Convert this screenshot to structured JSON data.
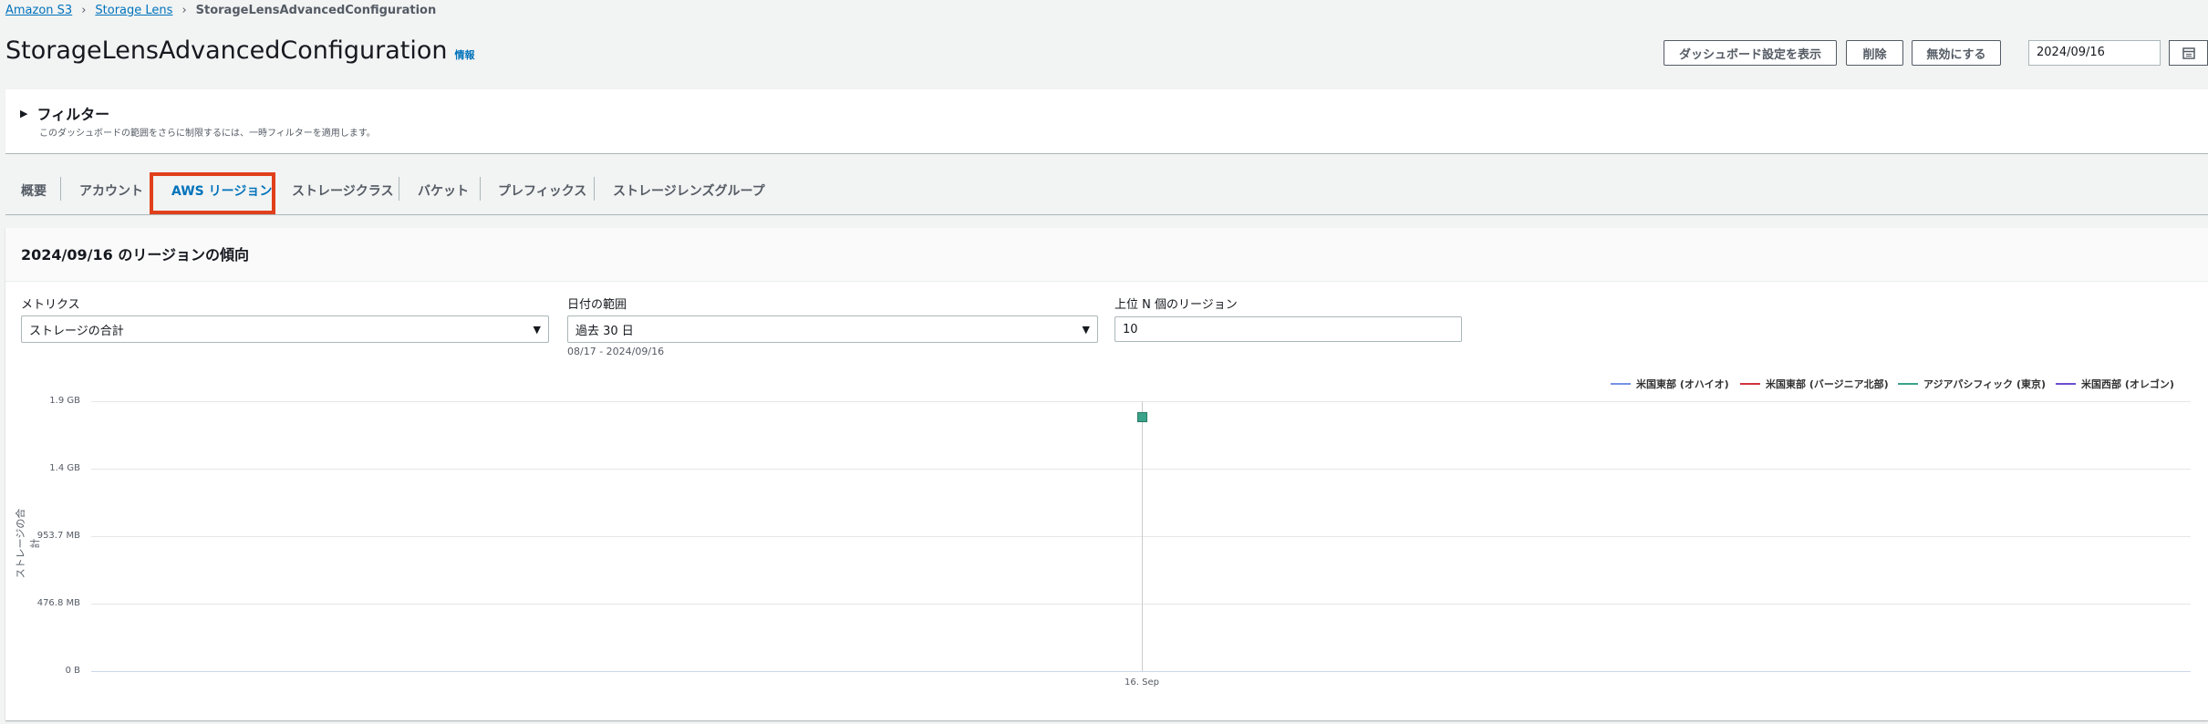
{
  "breadcrumb": {
    "items": [
      "Amazon S3",
      "Storage Lens"
    ],
    "current": "StorageLensAdvancedConfiguration"
  },
  "header": {
    "title": "StorageLensAdvancedConfiguration",
    "info_label": "情報",
    "buttons": {
      "view_dashboard_settings": "ダッシュボード設定を表示",
      "delete": "削除",
      "disable": "無効にする"
    },
    "date_value": "2024/09/16"
  },
  "filter": {
    "title": "フィルター",
    "description": "このダッシュボードの範囲をさらに制限するには、一時フィルターを適用します。"
  },
  "tabs": [
    {
      "label": "概要"
    },
    {
      "label": "アカウント"
    },
    {
      "label": "AWS リージョン",
      "active": true
    },
    {
      "label": "ストレージクラス"
    },
    {
      "label": "バケット"
    },
    {
      "label": "プレフィックス"
    },
    {
      "label": "ストレージレンズグループ"
    }
  ],
  "panel": {
    "title": "2024/09/16 のリージョンの傾向",
    "metrics": {
      "label": "メトリクス",
      "value": "ストレージの合計"
    },
    "date_range": {
      "label": "日付の範囲",
      "value": "過去 30 日",
      "hint": "08/17 - 2024/09/16"
    },
    "top_n": {
      "label": "上位 N 個のリージョン",
      "value": "10"
    }
  },
  "colors": {
    "accent": "#0073bb",
    "highlight_box": "#e0401c",
    "series_ohio": "#7492e6",
    "series_virginia": "#d1343e",
    "series_tokyo": "#3aa38a",
    "series_oregon": "#6b4fd1"
  },
  "chart_data": {
    "type": "line",
    "ylabel": "ストレージの合計",
    "x": [
      "16. Sep"
    ],
    "y_ticks": [
      "1.9 GB",
      "1.4 GB",
      "953.7 MB",
      "476.8 MB",
      "0 B"
    ],
    "ylim_gb": [
      0,
      1.9
    ],
    "legend_position": "top-right",
    "series": [
      {
        "name": "米国東部 (オハイオ)",
        "values": [
          null
        ]
      },
      {
        "name": "米国東部 (バージニア北部)",
        "values": [
          null
        ]
      },
      {
        "name": "アジアパシフィック (東京)",
        "values": [
          1.82
        ]
      },
      {
        "name": "米国西部 (オレゴン)",
        "values": [
          null
        ]
      }
    ]
  }
}
